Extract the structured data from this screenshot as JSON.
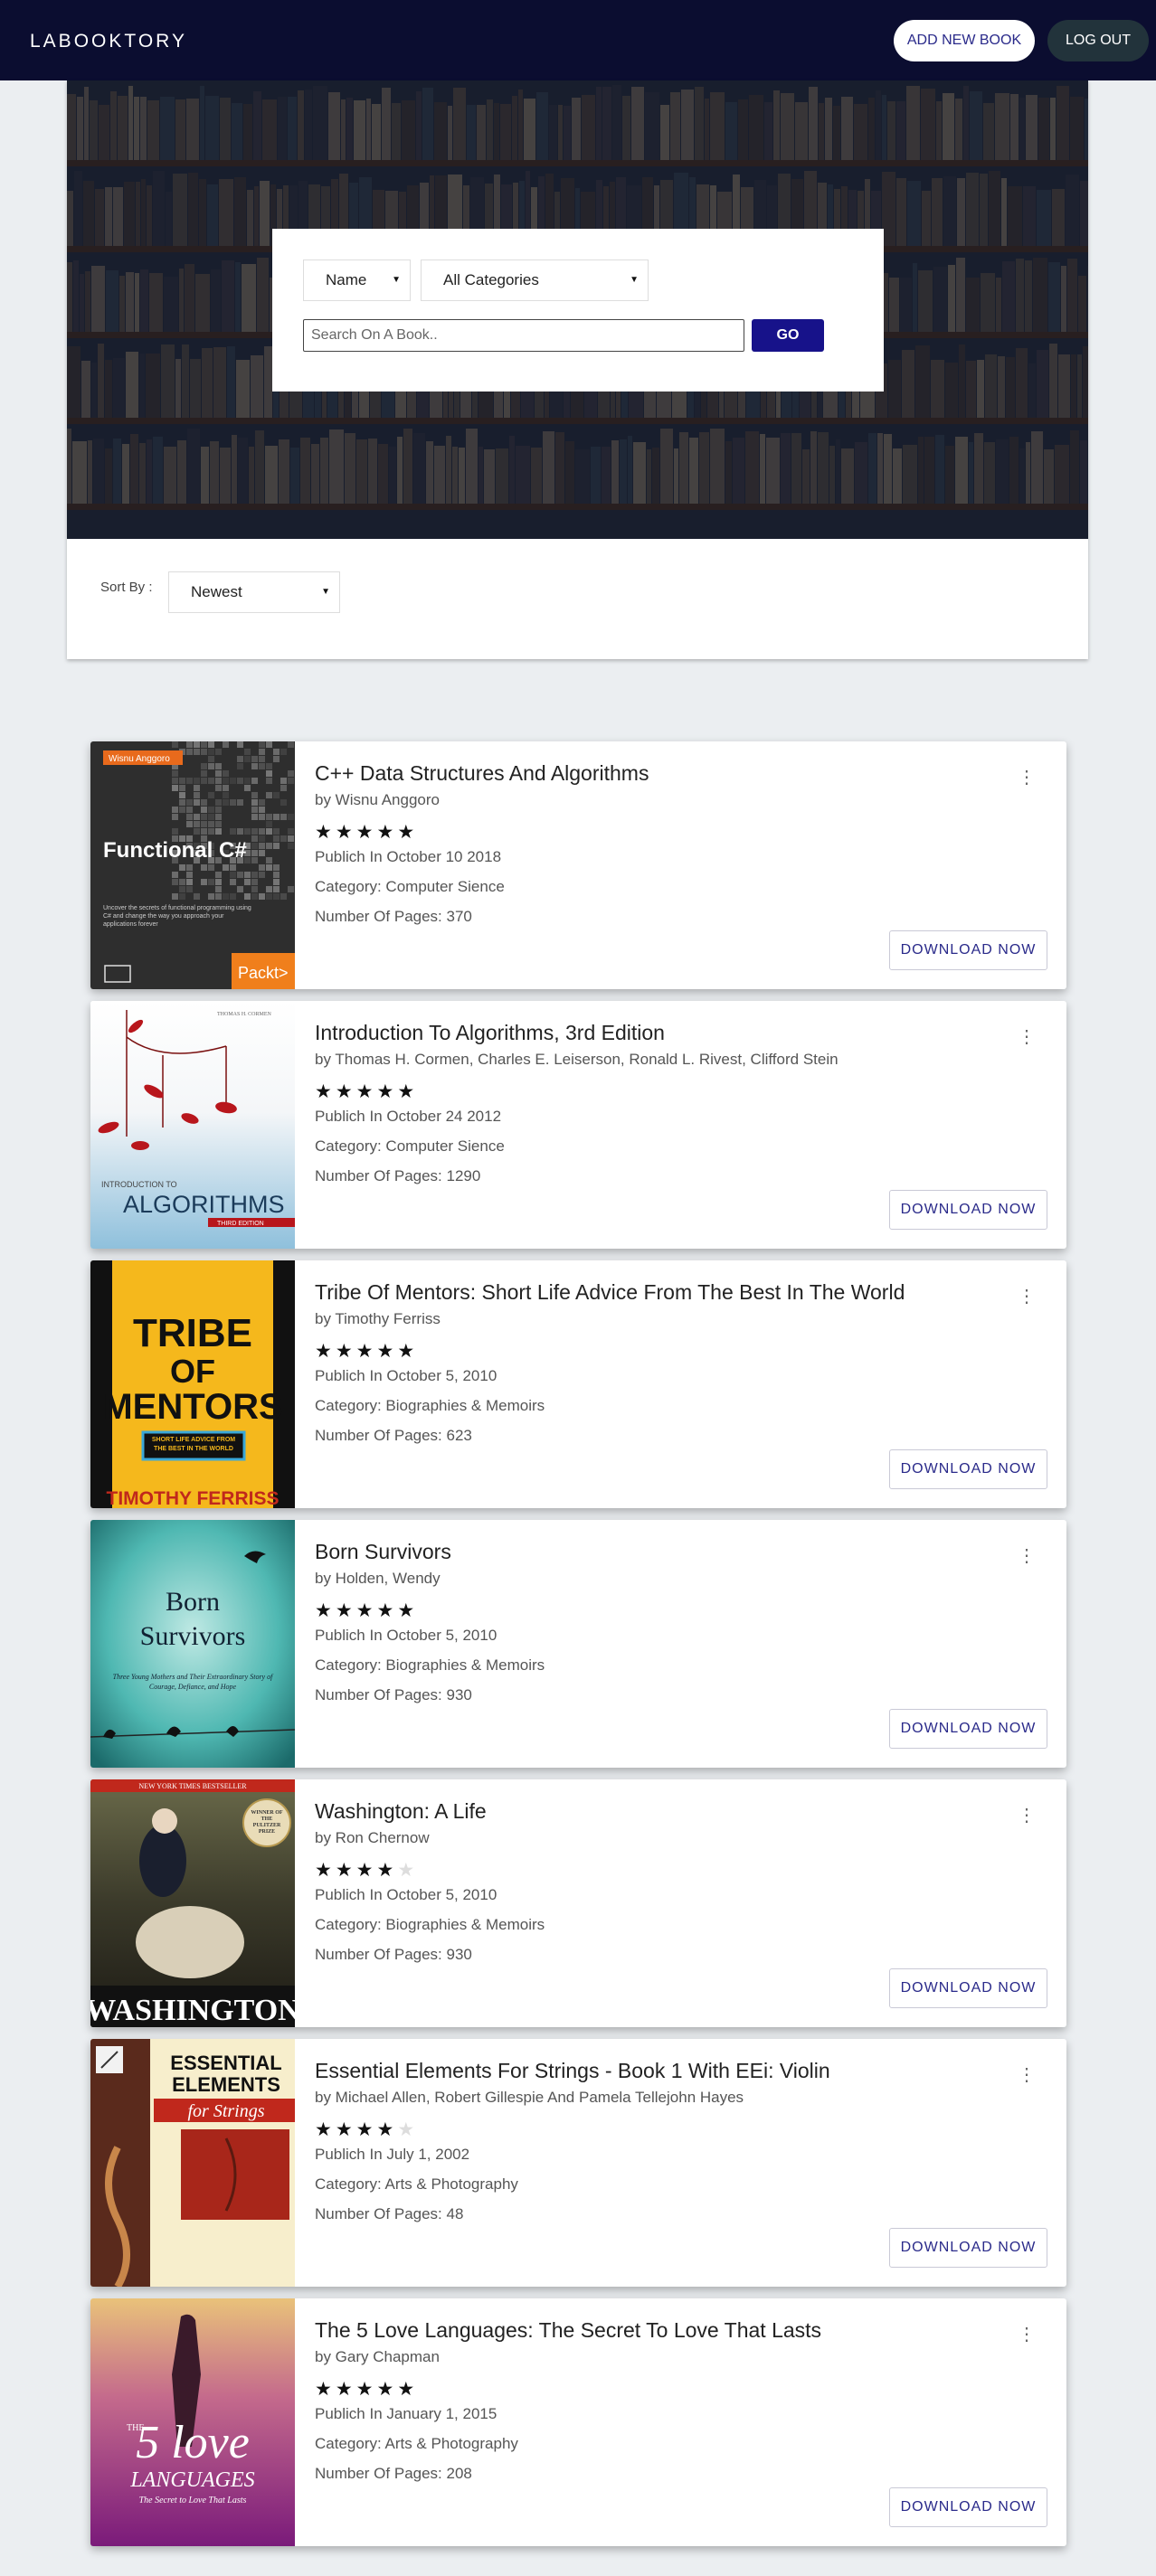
{
  "header": {
    "brand": "LABOOKTORY",
    "add_book_label": "ADD NEW BOOK",
    "logout_label": "LOG OUT"
  },
  "search": {
    "field_selected": "Name",
    "category_selected": "All Categories",
    "placeholder": "Search On A Book..",
    "go_label": "GO"
  },
  "sort": {
    "label": "Sort By :",
    "selected": "Newest"
  },
  "colors": {
    "navbar": "#0b0d30",
    "go_button": "#17128a",
    "logout_button": "#22333b",
    "accent_text": "#2a2a8a"
  },
  "books": [
    {
      "title": "C++ Data Structures And Algorithms",
      "author": "by Wisnu Anggoro",
      "rating": 5,
      "published": "Publich In October 10 2018",
      "category": "Category: Computer Sience",
      "pages": "Number Of Pages: 370",
      "download_label": "DOWNLOAD NOW",
      "cover": {
        "top_label": "Wisnu Anggoro",
        "title": "Functional C#",
        "blurb": "Uncover the secrets of functional programming using C# and change the way you approach your applications forever",
        "publisher": "Packt>"
      }
    },
    {
      "title": "Introduction To Algorithms, 3rd Edition",
      "author": "by Thomas H. Cormen, Charles E. Leiserson, Ronald L. Rivest, Clifford Stein",
      "rating": 5,
      "published": "Publich In October 24 2012",
      "category": "Category: Computer Sience",
      "pages": "Number Of Pages: 1290",
      "download_label": "DOWNLOAD NOW",
      "cover": {
        "authors": "THOMAS H. CORMEN",
        "intro": "INTRODUCTION TO",
        "title": "ALGORITHMS",
        "edition": "THIRD EDITION"
      }
    },
    {
      "title": "Tribe Of Mentors: Short Life Advice From The Best In The World",
      "author": "by Timothy Ferriss",
      "rating": 5,
      "published": "Publich In October 5, 2010",
      "category": "Category: Biographies & Memoirs",
      "pages": "Number Of Pages: 623",
      "download_label": "DOWNLOAD NOW",
      "cover": {
        "line1": "TRIBE",
        "line2": "OF",
        "line3": "MENTORS",
        "subtitle": "SHORT LIFE ADVICE FROM THE BEST IN THE WORLD",
        "author": "TIMOTHY FERRISS"
      }
    },
    {
      "title": "Born Survivors",
      "author": "by Holden, Wendy",
      "rating": 5,
      "published": "Publich In October 5, 2010",
      "category": "Category: Biographies & Memoirs",
      "pages": "Number Of Pages: 930",
      "download_label": "DOWNLOAD NOW",
      "cover": {
        "line1": "Born",
        "line2": "Survivors",
        "subtitle": "Three Young Mothers and Their Extraordinary Story of Courage, Defiance, and Hope"
      }
    },
    {
      "title": "Washington: A Life",
      "author": "by Ron Chernow",
      "rating": 4,
      "published": "Publich In October 5, 2010",
      "category": "Category: Biographies & Memoirs",
      "pages": "Number Of Pages: 930",
      "download_label": "DOWNLOAD NOW",
      "cover": {
        "banner": "NEW YORK TIMES BESTSELLER",
        "badge": "WINNER OF THE PULITZER PRIZE",
        "title": "WASHINGTON"
      }
    },
    {
      "title": "Essential Elements For Strings - Book 1 With EEi: Violin",
      "author": "by Michael Allen, Robert Gillespie And Pamela Tellejohn Hayes",
      "rating": 4,
      "published": "Publich In July 1, 2002",
      "category": "Category: Arts & Photography",
      "pages": "Number Of Pages: 48",
      "download_label": "DOWNLOAD NOW",
      "cover": {
        "line1": "ESSENTIAL",
        "line2": "ELEMENTS",
        "line3": "for Strings"
      }
    },
    {
      "title": "The 5 Love Languages: The Secret To Love That Lasts",
      "author": "by Gary Chapman",
      "rating": 5,
      "published": "Publich In January 1, 2015",
      "category": "Category: Arts & Photography",
      "pages": "Number Of Pages: 208",
      "download_label": "DOWNLOAD NOW",
      "cover": {
        "the": "THE",
        "title": "5 love",
        "languages": "LANGUAGES",
        "subtitle": "The Secret to Love That Lasts"
      }
    }
  ]
}
